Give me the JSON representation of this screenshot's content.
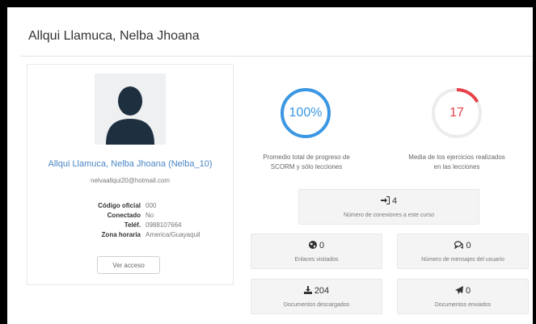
{
  "header": {
    "title": "Allqui Llamuca, Nelba Jhoana"
  },
  "profile": {
    "name": "Allqui Llamuca, Nelba Jhoana (Nelba_10)",
    "email": "nelvaallqui20@hotmail.com",
    "fields": [
      {
        "label": "Código oficial",
        "value": "000"
      },
      {
        "label": "Conectado",
        "value": "No"
      },
      {
        "label": "Teléf.",
        "value": "0988107664"
      },
      {
        "label": "Zona horaria",
        "value": "America/Guayaquil"
      }
    ],
    "access_button": "Ver acceso"
  },
  "gauges": {
    "progress": {
      "value": "100%",
      "fraction": 1.0,
      "color": "#3b97e3",
      "caption1": "Promedio total de progreso de",
      "caption2": "SCORM y sólo lecciones"
    },
    "exercises": {
      "value": "17",
      "fraction": 0.17,
      "color": "#e8414b",
      "caption1": "Media de los ejercicios realizados",
      "caption2": "en las lecciones"
    }
  },
  "stats": {
    "connections": {
      "value": "4",
      "label": "Número de conexiones a este curso",
      "icon": "sign-in-icon"
    },
    "links": {
      "value": "0",
      "label": "Enlaces visitados",
      "icon": "globe-icon"
    },
    "messages": {
      "value": "0",
      "label": "Número de mensajes del usuario",
      "icon": "comments-icon"
    },
    "downloads": {
      "value": "204",
      "label": "Documentos descargados",
      "icon": "download-icon"
    },
    "sent": {
      "value": "0",
      "label": "Documentos enviados",
      "icon": "paper-plane-icon"
    }
  },
  "colors": {
    "link": "#4a86c5",
    "track": "#ececec"
  }
}
